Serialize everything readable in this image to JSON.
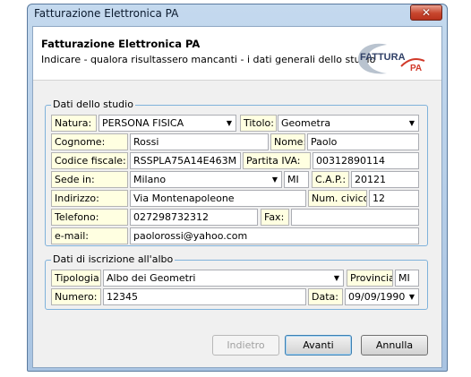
{
  "window": {
    "title": "Fatturazione Elettronica PA",
    "close_glyph": "✕"
  },
  "header": {
    "title": "Fatturazione Elettronica PA",
    "subtitle": "Indicare - qualora risultassero mancanti - i dati generali dello studio",
    "logo_text": "FATTURA",
    "logo_sub": "PA"
  },
  "studio": {
    "legend": "Dati dello studio",
    "natura": {
      "label": "Natura:",
      "value": "PERSONA FISICA"
    },
    "titolo": {
      "label": "Titolo:",
      "value": "Geometra"
    },
    "cognome": {
      "label": "Cognome:",
      "value": "Rossi"
    },
    "nome": {
      "label": "Nome:",
      "value": "Paolo"
    },
    "codice_fiscale": {
      "label": "Codice fiscale:",
      "value": "RSSPLA75A14E463M"
    },
    "partita_iva": {
      "label": "Partita IVA:",
      "value": "00312890114"
    },
    "sede": {
      "label": "Sede in:",
      "value": "Milano",
      "prov": "MI"
    },
    "cap": {
      "label": "C.A.P.:",
      "value": "20121"
    },
    "indirizzo": {
      "label": "Indirizzo:",
      "value": "Via Montenapoleone"
    },
    "civico": {
      "label": "Num. civico:",
      "value": "12"
    },
    "telefono": {
      "label": "Telefono:",
      "value": "027298732312"
    },
    "fax": {
      "label": "Fax:",
      "value": ""
    },
    "email": {
      "label": "e-mail:",
      "value": "paolorossi@yahoo.com"
    }
  },
  "albo": {
    "legend": "Dati di iscrizione all'albo",
    "tipologia": {
      "label": "Tipologia:",
      "value": "Albo dei Geometri"
    },
    "provincia": {
      "label": "Provincia:",
      "value": "MI"
    },
    "numero": {
      "label": "Numero:",
      "value": "12345"
    },
    "data": {
      "label": "Data:",
      "value": "09/09/1990"
    }
  },
  "buttons": {
    "back": "Indietro",
    "next": "Avanti",
    "cancel": "Annulla"
  },
  "colors": {
    "label_bg": "#ffffe1",
    "group_border": "#7fb2db",
    "close_red": "#c8462e"
  }
}
